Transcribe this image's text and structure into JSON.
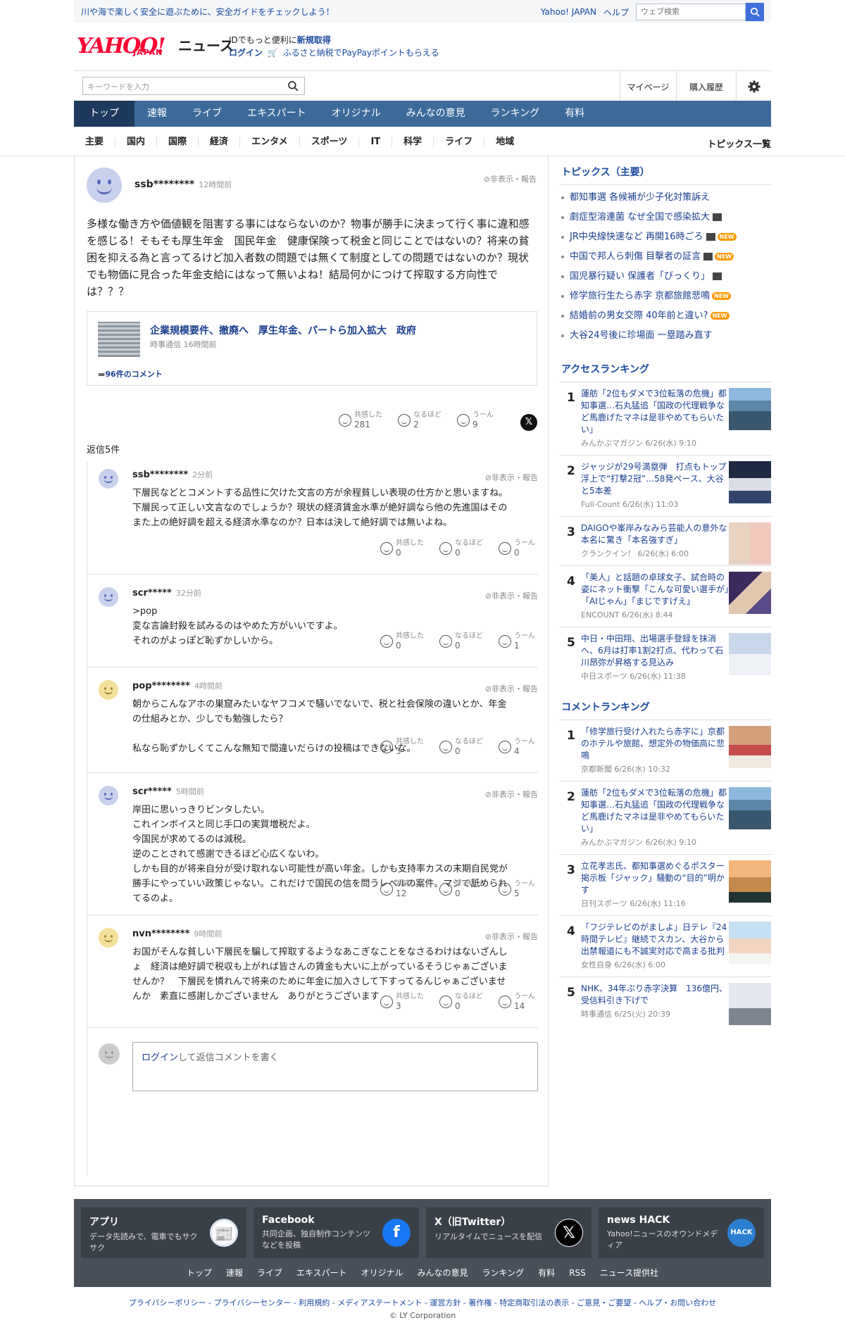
{
  "strip": {
    "message": "川や海で楽しく安全に遊ぶために、安全ガイドをチェックしよう！",
    "yahoo_japan": "Yahoo! JAPAN",
    "help": "ヘルプ",
    "web_search_placeholder": "ウェブ検索"
  },
  "header": {
    "logo": "YAHOO!",
    "logo_sub": "JAPAN",
    "service": "ニュース",
    "promo_line1_a": "IDでもっと便利に",
    "promo_line1_b": "新規取得",
    "promo_login": "ログイン",
    "promo_line2": "ふるさと納税でPayPayポイントもらえる"
  },
  "search": {
    "placeholder": "キーワードを入力",
    "mypage": "マイページ",
    "history": "購入履歴"
  },
  "nav": [
    "トップ",
    "速報",
    "ライブ",
    "エキスパート",
    "オリジナル",
    "みんなの意見",
    "ランキング",
    "有料"
  ],
  "subnav": [
    "主要",
    "国内",
    "国際",
    "経済",
    "エンタメ",
    "スポーツ",
    "IT",
    "科学",
    "ライフ",
    "地域"
  ],
  "topics_all": "トピックス一覧",
  "main_comment": {
    "user": "ssb********",
    "time": "12時間前",
    "hide": "非表示・報告",
    "text": "多様な働き方や価値観を阻害する事にはならないのか？物事が勝手に決まって行く事に違和感を感じる！そもそも厚生年金　国民年金　健康保険って税金と同じことではないの？将来の貧困を抑える為と言ってるけど加入者数の問題では無くて制度としての問題ではないのか？現状でも物価に見合った年金支給にはなって無いよね！結局何かにつけて搾取する方向性では？？？",
    "article_title": "企業規模要件、撤廃へ　厚生年金、パートら加入拡大　政府",
    "article_source": "時事通信",
    "article_time": "16時間前",
    "article_comments": "96件のコメント",
    "reactions": {
      "agree_label": "共感した",
      "agree": "281",
      "hmm_label": "なるほど",
      "hmm": "2",
      "um_label": "うーん",
      "um": "9"
    }
  },
  "replies_label": "返信5件",
  "reaction_labels": {
    "agree": "共感した",
    "hmm": "なるほど",
    "um": "うーん"
  },
  "replies": [
    {
      "user": "ssb********",
      "time": "2分前",
      "hide": "非表示・報告",
      "lines": [
        "下層民などとコメントする品性に欠けた文言の方が余程貧しい表現の仕方かと思いますね。",
        "下層民って正しい文言なのでしょうか？現状の経済賃金水準が絶好調なら他の先進国はその",
        "また上の絶好調を超える経済水準なのか？日本は決して絶好調では無いよね。"
      ],
      "agree": "0",
      "hmm": "0",
      "um": "0"
    },
    {
      "user": "scr*****",
      "time": "32分前",
      "hide": "非表示・報告",
      "lines": [
        ">pop",
        "変な言論封殺を試みるのはやめた方がいいですよ。",
        "それのがよっぽど恥ずかしいから。"
      ],
      "agree": "0",
      "hmm": "0",
      "um": "1"
    },
    {
      "user": "pop********",
      "time": "4時間前",
      "hide": "非表示・報告",
      "lines": [
        "朝からこんなアホの巣窟みたいなヤフコメで騒いでないで、税と社会保険の違いとか、年金",
        "の仕組みとか、少しでも勉強したら？",
        "",
        "私なら恥ずかしくてこんな無知で間違いだらけの投稿はできないな。"
      ],
      "agree": "3",
      "hmm": "0",
      "um": "4"
    },
    {
      "user": "scr*****",
      "time": "5時間前",
      "hide": "非表示・報告",
      "lines": [
        "岸田に思いっきりビンタしたい。",
        "これインボイスと同じ手口の実質増税だよ。",
        "今国民が求めてるのは減税。",
        "逆のことされて感謝できるほど心広くないわ。",
        "しかも目的が将来自分が受け取れない可能性が高い年金。しかも支持率カスの末期自民党が",
        "勝手にやっていい政策じゃない。これだけで国民の信を問うレベルの案件。マジで舐められ",
        "てるのよ。"
      ],
      "agree": "12",
      "hmm": "0",
      "um": "5"
    },
    {
      "user": "nvn********",
      "time": "9時間前",
      "hide": "非表示・報告",
      "lines": [
        "お国がそんな貧しい下層民を騙して搾取するようなあこぎなことをなさるわけはないざんし",
        "ょ　経済は絶好調で税収も上がれば皆さんの賃金も大いに上がっているそうじゃぁございま",
        "せんか？　下層民を憐れんで将来のために年金に加入さして下すってるんじゃぁございませ",
        "んか　素直に感謝しかございません　ありがとうございます"
      ],
      "agree": "3",
      "hmm": "0",
      "um": "14"
    }
  ],
  "reply_box": {
    "login": "ログイン",
    "text": "して返信コメントを書く"
  },
  "sidebar": {
    "topics_title": "トピックス（主要）",
    "topics": [
      {
        "text": "都知事選 各候補が少子化対策訴え",
        "video": false,
        "new": false
      },
      {
        "text": "劇症型溶連菌 なぜ全国で感染拡大",
        "video": true,
        "new": false
      },
      {
        "text": "JR中央線快速など 再開16時ごろ",
        "video": true,
        "new": true
      },
      {
        "text": "中国で邦人ら刺傷 目撃者の証言",
        "video": true,
        "new": true
      },
      {
        "text": "国児暴行疑い 保護者「びっくり」",
        "video": true,
        "new": false
      },
      {
        "text": "修学旅行生たら赤字 京都旅館悲鳴",
        "video": false,
        "new": true
      },
      {
        "text": "結婚前の男女交際 40年前と違い?",
        "video": false,
        "new": true
      },
      {
        "text": "大谷24号後に珍場面 一塁踏み直す",
        "video": false,
        "new": false
      }
    ],
    "new_label": "NEW",
    "access_title": "アクセスランキング",
    "access": [
      {
        "rank": "1",
        "title": "蓮舫「2位もダメで3位転落の危機」都知事選…石丸猛追「国政の代理戦争など馬鹿げたマネは是非やめてもらいたい」",
        "meta": "みんかぶマガジン 6/26(水) 9:10",
        "thumb": "city"
      },
      {
        "rank": "2",
        "title": "ジャッジが29号満塁弾　打点もトップ浮上で“打撃2冠”…58発ペース、大谷と5本差",
        "meta": "Full-Count 6/26(水) 11:03",
        "thumb": "baseball"
      },
      {
        "rank": "3",
        "title": "DAIGOや峯岸みなみら芸能人の意外な本名に驚き「本名強すぎ」",
        "meta": "クランクイン！ 6/26(水) 6:00",
        "thumb": "people"
      },
      {
        "rank": "4",
        "title": "「美人」と話題の卓球女子、試合時の姿にネット衝撃「こんな可愛い選手が」「AIじゃん」「まじですげえ」",
        "meta": "ENCOUNT 6/26(水) 8:44",
        "thumb": "pingpong"
      },
      {
        "rank": "5",
        "title": "中日・中田翔、出場選手登録を抹消へ、6月は打率1割2打点、代わって石川昂弥が昇格する見込み",
        "meta": "中日スポーツ 6/26(水) 11:38",
        "thumb": "player"
      }
    ],
    "comment_title": "コメントランキング",
    "comment": [
      {
        "rank": "1",
        "title": "「修学旅行受け入れたら赤字に」京都のホテルや旅館、想定外の物価高に悲鳴",
        "meta": "京都新聞 6/26(水) 10:32",
        "thumb": "crowd"
      },
      {
        "rank": "2",
        "title": "蓮舫「2位もダメで3位転落の危機」都知事選…石丸猛追「国政の代理戦争など馬鹿げたマネは是非やめてもらいたい」",
        "meta": "みんかぶマガジン 6/26(水) 9:10",
        "thumb": "city"
      },
      {
        "rank": "3",
        "title": "立花孝志氏、都知事選めぐるポスター掲示板「ジャック」騒動の“目的”明かす",
        "meta": "日刊スポーツ 6/26(水) 11:16",
        "thumb": "man"
      },
      {
        "rank": "4",
        "title": "「フジテレビのがましよ」日テレ『24時間テレビ』継続でスカン、大谷から出禁報道にも不誠実対応で高まる批判",
        "meta": "女性自身 6/26(水) 6:00",
        "thumb": "woman"
      },
      {
        "rank": "5",
        "title": "NHK、34年ぶり赤字決算　136億円、受信料引き下げで",
        "meta": "時事通信 6/25(火) 20:39",
        "thumb": "building"
      }
    ]
  },
  "footer": {
    "cards": [
      {
        "title": "アプリ",
        "desc": "データ先読みで、電車でもサクサク",
        "icon": "app-icon"
      },
      {
        "title": "Facebook",
        "desc": "共同企画、独自制作コンテンツなどを投稿",
        "icon": "facebook-icon"
      },
      {
        "title": "X（旧Twitter）",
        "desc": "リアルタイムでニュースを配信",
        "icon": "x-icon"
      },
      {
        "title": "news HACK",
        "desc": "Yahoo!ニュースのオウンドメディア",
        "icon": "newshack-icon"
      }
    ],
    "nav": [
      "トップ",
      "速報",
      "ライブ",
      "エキスパート",
      "オリジナル",
      "みんなの意見",
      "ランキング",
      "有料",
      "RSS",
      "ニュース提供社"
    ],
    "legal": "プライバシーポリシー - プライバシーセンター - 利用規約 - メディアステートメント - 運営方針 - 著作権 - 特定商取引法の表示 - ご意見・ご要望 - ヘルプ・お問い合わせ",
    "copyright": "© LY Corporation"
  }
}
